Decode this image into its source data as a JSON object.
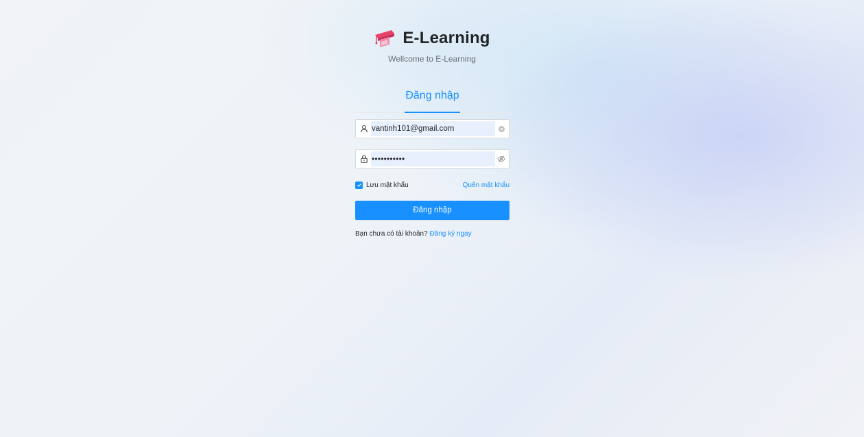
{
  "brand": {
    "title": "E-Learning",
    "subtitle": "Wellcome to E-Learning",
    "logo_icon": "graduation-cap-icon",
    "logo_colors": [
      "#e8426b",
      "#f9a8c0"
    ]
  },
  "login": {
    "tab_label": "Đăng nhập",
    "email_field": {
      "value": "vantinh101@gmail.com",
      "prefix_icon": "user-icon",
      "suffix_icon": "clear-icon"
    },
    "password_field": {
      "masked_value": "•••••••••••",
      "prefix_icon": "lock-icon",
      "suffix_icon": "eye-invisible-icon"
    },
    "remember_label": "Lưu mật khẩu",
    "remember_checked": true,
    "forgot_label": "Quên mật khẩu",
    "submit_label": "Đăng nhập",
    "register_prompt": "Bạn chưa có tài khoản?",
    "register_link": "Đăng ký ngay"
  },
  "colors": {
    "accent": "#1890ff",
    "background": "#f0f2f5"
  }
}
